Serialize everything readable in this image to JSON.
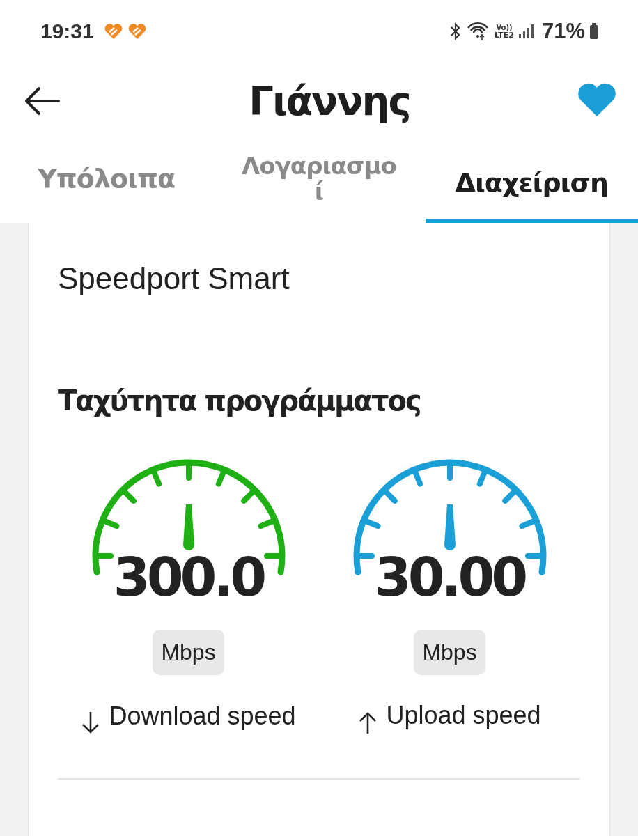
{
  "status_bar": {
    "time": "19:31",
    "volte_label": "Vo))",
    "lte_label": "LTE2",
    "battery": "71%"
  },
  "header": {
    "title": "Γιάννης",
    "favorite": true
  },
  "tabs": [
    {
      "lines": [
        "Υπόλοιπα"
      ],
      "selected": false
    },
    {
      "lines": [
        "Λογαριασμο",
        "ί"
      ],
      "selected": false
    },
    {
      "lines": [
        "Διαχείριση"
      ],
      "selected": true
    }
  ],
  "card": {
    "router_value": "Speedport Smart",
    "speed_heading": "Ταχύτητα προγράμματος",
    "speeds": [
      {
        "kind": "download",
        "value": "300.0",
        "unit": "Mbps",
        "label": "Download speed",
        "color": "#1eb014"
      },
      {
        "kind": "upload",
        "value": "30.00",
        "unit": "Mbps",
        "label": "Upload speed",
        "color": "#1a9fd6"
      }
    ]
  }
}
